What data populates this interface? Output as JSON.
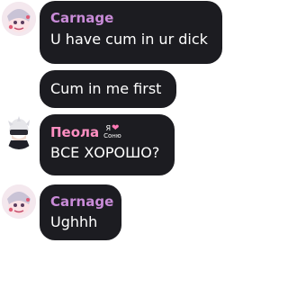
{
  "colors": {
    "bubble_bg": "#1c1c21",
    "carnage_name": "#c98bd8",
    "peola_name": "#ff8fc2",
    "text": "#ffffff"
  },
  "messages": [
    {
      "author": "Carnage",
      "text": "U have cum in ur dick",
      "avatar": "carnage-avatar"
    },
    {
      "author": "",
      "text": "Cum in me first"
    },
    {
      "author": "Пеола",
      "badge_top": "Я",
      "badge_heart": "❤",
      "badge_bottom": "Соню",
      "text": "ВСЕ ХОРОШО?",
      "avatar": "peola-avatar"
    },
    {
      "author": "Carnage",
      "text": "Ughhh",
      "avatar": "carnage-avatar"
    }
  ]
}
